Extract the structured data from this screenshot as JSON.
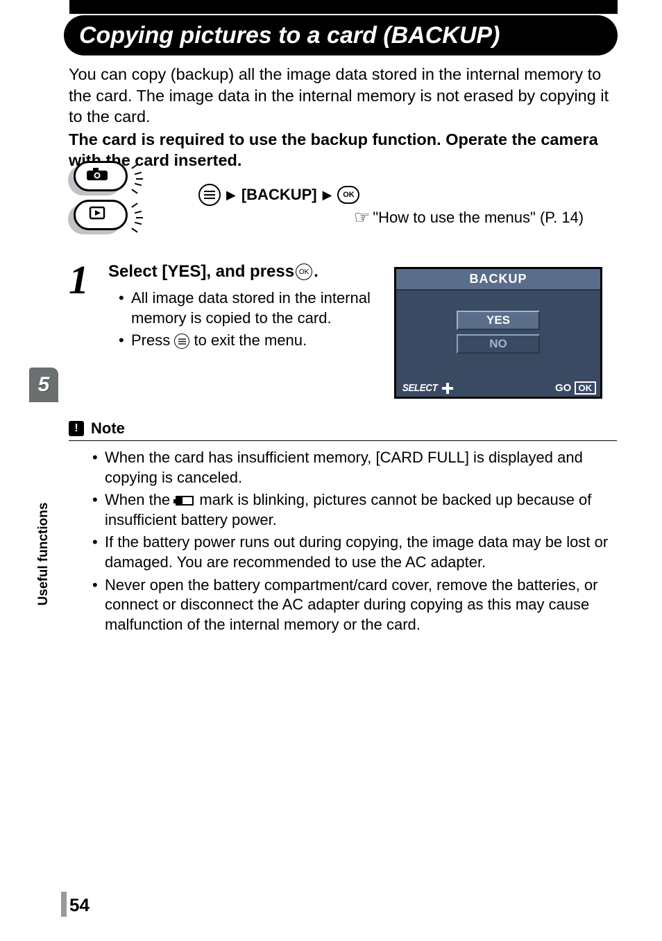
{
  "title": "Copying pictures to a card (BACKUP)",
  "intro_text": "You can copy (backup) all the image data stored in the internal memory to the card. The image data in the internal memory is not erased by copying it to the card.",
  "intro_bold": "The card is required to use the backup function. Operate the camera with the card inserted.",
  "nav": {
    "menu_item": "[BACKUP]",
    "reference": "\"How to use the menus\" (P. 14)"
  },
  "step": {
    "number": "1",
    "title_before": "Select [YES], and press ",
    "title_after": ".",
    "bullets": {
      "b1": "All image data stored in the internal memory is copied to the card.",
      "b2_before": "Press ",
      "b2_after": " to exit the menu."
    }
  },
  "lcd": {
    "title": "BACKUP",
    "opt_yes": "YES",
    "opt_no": "NO",
    "footer_select": "SELECT",
    "footer_go": "GO",
    "footer_ok": "OK"
  },
  "note": {
    "heading": "Note",
    "items": {
      "n1": "When the card has insufficient memory, [CARD FULL] is displayed and copying is canceled.",
      "n2_before": "When the ",
      "n2_after": " mark is blinking, pictures cannot be backed up because of insufficient battery power.",
      "n3": "If the battery power runs out during copying, the image data may be lost or damaged. You are recommended to use the AC adapter.",
      "n4": "Never open the battery compartment/card cover, remove the batteries, or connect or disconnect the AC adapter during copying as this may cause malfunction of the internal memory or the card."
    }
  },
  "side": {
    "chapter_num": "5",
    "chapter_label": "Useful functions"
  },
  "page_number": "54"
}
